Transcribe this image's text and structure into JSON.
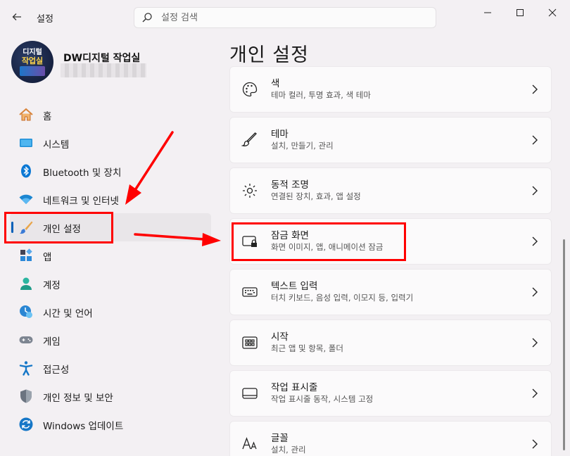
{
  "titlebar": {
    "app_title": "설정",
    "search_placeholder": "설정 검색"
  },
  "profile": {
    "avatar_line1": "디지털",
    "avatar_line2": "작업실",
    "name": "DW디지털 작업실"
  },
  "sidebar": {
    "items": [
      {
        "label": "홈",
        "icon": "home-icon"
      },
      {
        "label": "시스템",
        "icon": "system-icon"
      },
      {
        "label": "Bluetooth 및 장치",
        "icon": "bluetooth-icon"
      },
      {
        "label": "네트워크 및 인터넷",
        "icon": "wifi-icon"
      },
      {
        "label": "개인 설정",
        "icon": "personalization-brush-icon",
        "active": true
      },
      {
        "label": "앱",
        "icon": "apps-icon"
      },
      {
        "label": "계정",
        "icon": "account-icon"
      },
      {
        "label": "시간 및 언어",
        "icon": "time-language-icon"
      },
      {
        "label": "게임",
        "icon": "gamepad-icon"
      },
      {
        "label": "접근성",
        "icon": "accessibility-icon"
      },
      {
        "label": "개인 정보 및 보안",
        "icon": "shield-icon"
      },
      {
        "label": "Windows 업데이트",
        "icon": "update-icon"
      }
    ]
  },
  "main": {
    "title": "개인 설정",
    "cards": [
      {
        "title": "색",
        "subtitle": "테마 컬러, 투명 효과, 색 테마",
        "icon": "palette-icon"
      },
      {
        "title": "테마",
        "subtitle": "설치, 만들기, 관리",
        "icon": "brush-icon"
      },
      {
        "title": "동적 조명",
        "subtitle": "연결된 장치, 효과, 앱 설정",
        "icon": "dynamic-lighting-icon"
      },
      {
        "title": "잠금 화면",
        "subtitle": "화면 이미지, 앱, 애니메이션 잠금",
        "icon": "lock-screen-icon"
      },
      {
        "title": "텍스트 입력",
        "subtitle": "터치 키보드, 음성 입력, 이모지 등, 입력기",
        "icon": "keyboard-icon"
      },
      {
        "title": "시작",
        "subtitle": "최근 앱 및 항목, 폴더",
        "icon": "start-icon"
      },
      {
        "title": "작업 표시줄",
        "subtitle": "작업 표시줄 동작, 시스템 고정",
        "icon": "taskbar-icon"
      },
      {
        "title": "글꼴",
        "subtitle": "설치, 관리",
        "icon": "fonts-icon"
      }
    ]
  },
  "colors": {
    "accent": "#005fb8",
    "annotation": "#ff0000"
  }
}
